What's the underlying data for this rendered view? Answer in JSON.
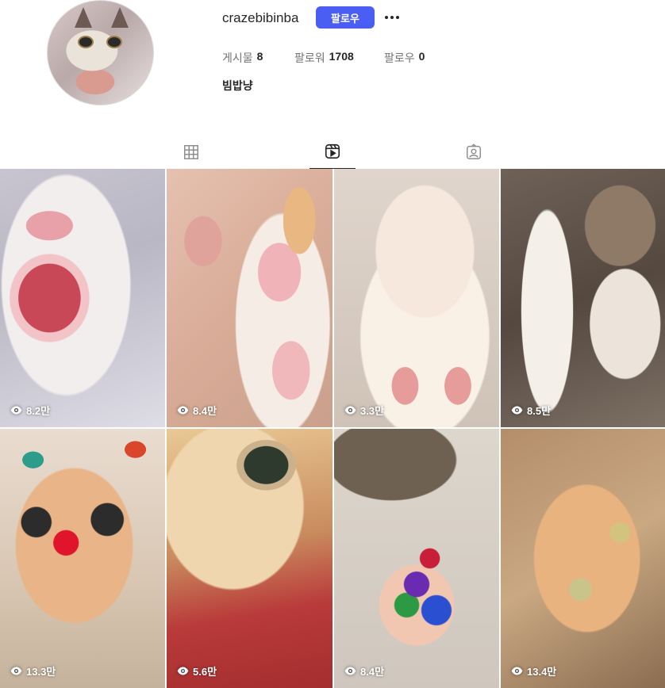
{
  "profile": {
    "username": "crazebibinba",
    "follow_label": "팔로우",
    "name": "빔밥냥",
    "stats": {
      "posts_label": "게시물",
      "posts_count": "8",
      "followers_label": "팔로워",
      "followers_count": "1708",
      "following_label": "팔로우",
      "following_count": "0"
    }
  },
  "tabs": [
    {
      "icon": "grid-icon",
      "active": false
    },
    {
      "icon": "reels-icon",
      "active": true
    },
    {
      "icon": "tagged-icon",
      "active": false
    }
  ],
  "reels": [
    {
      "views": "8.2만"
    },
    {
      "views": "8.4만"
    },
    {
      "views": "3.3만"
    },
    {
      "views": "8.5만"
    },
    {
      "views": "13.3만"
    },
    {
      "views": "5.6만"
    },
    {
      "views": "8.4만"
    },
    {
      "views": "13.4만"
    }
  ],
  "colors": {
    "follow_button": "#4a5ef3",
    "text_primary": "#262626",
    "text_secondary": "#737373"
  }
}
